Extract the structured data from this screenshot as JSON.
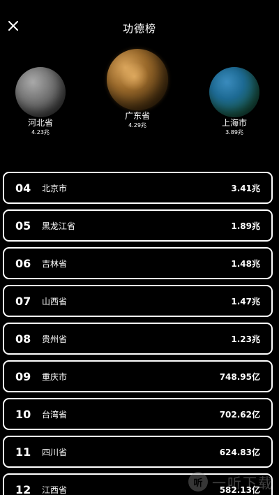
{
  "header": {
    "title": "功德榜",
    "close_icon": "close-icon"
  },
  "podium": {
    "first": {
      "province": "广东省",
      "value": "4.29兆",
      "color": "#9b6a2b"
    },
    "second": {
      "province": "河北省",
      "value": "4.23兆",
      "color": "#7a7a7a"
    },
    "third": {
      "province": "上海市",
      "value": "3.89兆",
      "color": "#1d6a93"
    }
  },
  "rankings": [
    {
      "rank": "04",
      "province": "北京市",
      "amount": "3.41兆"
    },
    {
      "rank": "05",
      "province": "黑龙江省",
      "amount": "1.89兆"
    },
    {
      "rank": "06",
      "province": "吉林省",
      "amount": "1.48兆"
    },
    {
      "rank": "07",
      "province": "山西省",
      "amount": "1.47兆"
    },
    {
      "rank": "08",
      "province": "贵州省",
      "amount": "1.23兆"
    },
    {
      "rank": "09",
      "province": "重庆市",
      "amount": "748.95亿"
    },
    {
      "rank": "10",
      "province": "台湾省",
      "amount": "702.62亿"
    },
    {
      "rank": "11",
      "province": "四川省",
      "amount": "624.83亿"
    },
    {
      "rank": "12",
      "province": "江西省",
      "amount": "582.13亿"
    }
  ],
  "watermark": {
    "logo": "听",
    "text": "一听下载"
  }
}
